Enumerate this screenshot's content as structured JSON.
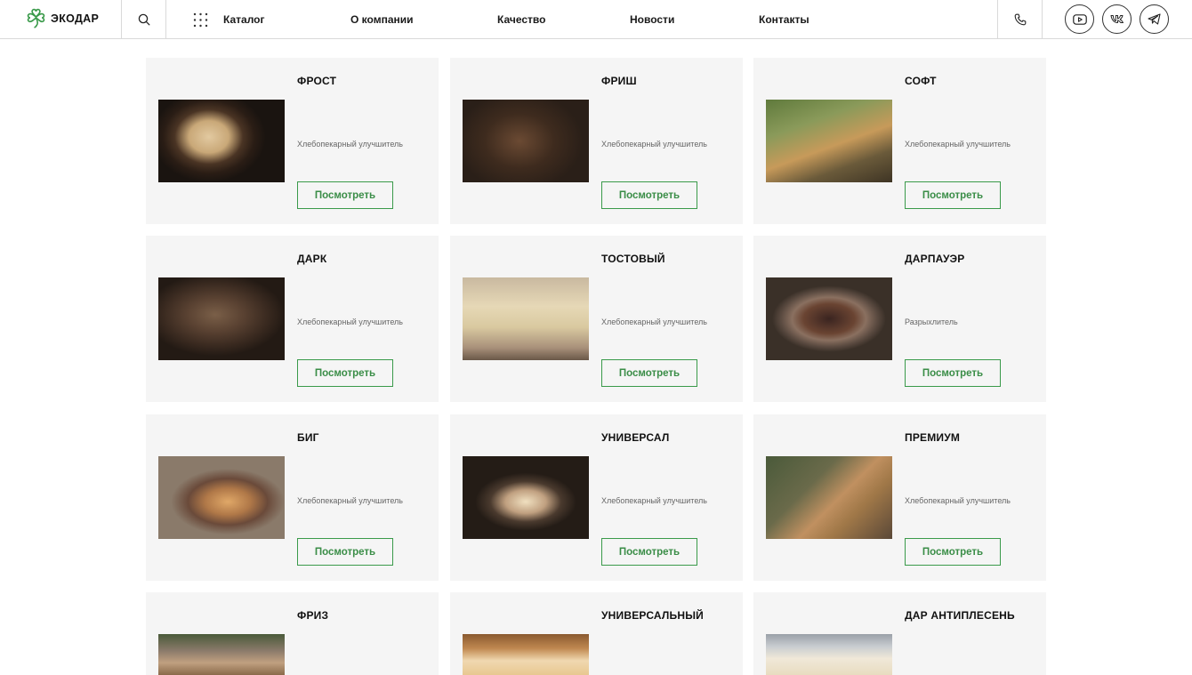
{
  "header": {
    "brand": "ЭКОДАР",
    "catalog_label": "Каталог",
    "nav": [
      "О компании",
      "Качество",
      "Новости",
      "Контакты"
    ]
  },
  "colors": {
    "accent_green": "#3a9a4a",
    "card_bg": "#f5f5f5",
    "border": "#d9d9d9"
  },
  "cards": [
    {
      "title": "ФРОСТ",
      "desc": "Хлебопекарный улучшитель",
      "button": "Посмотреть",
      "image": "bread-photo"
    },
    {
      "title": "ФРИШ",
      "desc": "Хлебопекарный улучшитель",
      "button": "Посмотреть",
      "image": "bread-photo"
    },
    {
      "title": "СОФТ",
      "desc": "Хлебопекарный улучшитель",
      "button": "Посмотреть",
      "image": "hotdog-photo"
    },
    {
      "title": "ДАРК",
      "desc": "Хлебопекарный улучшитель",
      "button": "Посмотреть",
      "image": "bread-photo"
    },
    {
      "title": "ТОСТОВЫЙ",
      "desc": "Хлебопекарный улучшитель",
      "button": "Посмотреть",
      "image": "toast-photo"
    },
    {
      "title": "ДАРПАУЭР",
      "desc": "Разрыхлитель",
      "button": "Посмотреть",
      "image": "pie-photo"
    },
    {
      "title": "БИГ",
      "desc": "Хлебопекарный улучшитель",
      "button": "Посмотреть",
      "image": "bread-photo"
    },
    {
      "title": "УНИВЕРСАЛ",
      "desc": "Хлебопекарный улучшитель",
      "button": "Посмотреть",
      "image": "bread-photo"
    },
    {
      "title": "ПРЕМИУМ",
      "desc": "Хлебопекарный улучшитель",
      "button": "Посмотреть",
      "image": "buns-photo"
    },
    {
      "title": "ФРИЗ",
      "desc": "",
      "button": "",
      "image": "bread-photo"
    },
    {
      "title": "УНИВЕРСАЛЬНЫЙ",
      "desc": "",
      "button": "",
      "image": "bread-photo"
    },
    {
      "title": "ДАР АНТИПЛЕСЕНЬ",
      "desc": "",
      "button": "",
      "image": "bread-photo"
    }
  ]
}
